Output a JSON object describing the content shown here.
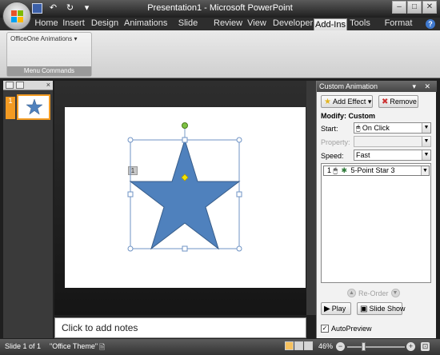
{
  "window": {
    "title": "Presentation1 - Microsoft PowerPoint",
    "controls": {
      "minimize": "–",
      "maximize": "□",
      "close": "✕"
    }
  },
  "quick_access": {
    "save": "save-icon",
    "undo": "↶",
    "redo": "↻",
    "customize": "▾"
  },
  "ribbon": {
    "tabs": [
      "Home",
      "Insert",
      "Design",
      "Animations",
      "Slide Show",
      "Review",
      "View",
      "Developer",
      "Add-Ins",
      "Tools",
      "Format"
    ],
    "active_tab": "Add-Ins",
    "help": "?",
    "group": {
      "button_label": "OfficeOne Animations ▾",
      "label": "Menu Commands"
    }
  },
  "thumbnails": {
    "slide_number": "1",
    "close": "×"
  },
  "slide": {
    "animation_tag": "1"
  },
  "notes": {
    "placeholder": "Click to add notes"
  },
  "custom_animation": {
    "title": "Custom Animation",
    "title_controls": "▾ ✕",
    "add_effect_label": "Add Effect",
    "remove_label": "Remove",
    "modify_heading": "Modify: Custom",
    "start_label": "Start:",
    "start_value": "On Click",
    "property_label": "Property:",
    "property_value": "",
    "speed_label": "Speed:",
    "speed_value": "Fast",
    "animation_item": {
      "order": "1",
      "name": "5-Point Star 3"
    },
    "reorder_label": "Re-Order",
    "play_label": "Play",
    "slideshow_label": "Slide Show",
    "autopreview_label": "AutoPreview",
    "autopreview_checked": "✓"
  },
  "status": {
    "slide_info": "Slide 1 of 1",
    "theme": "\"Office Theme\"",
    "zoom": "46%"
  },
  "colors": {
    "star_fill": "#4f81bd",
    "star_stroke": "#385d8a",
    "accent_orange": "#f39b23",
    "selection_handle": "#6f93c4",
    "rotate_handle": "#7dc243",
    "adjust_handle": "#f4e400"
  }
}
